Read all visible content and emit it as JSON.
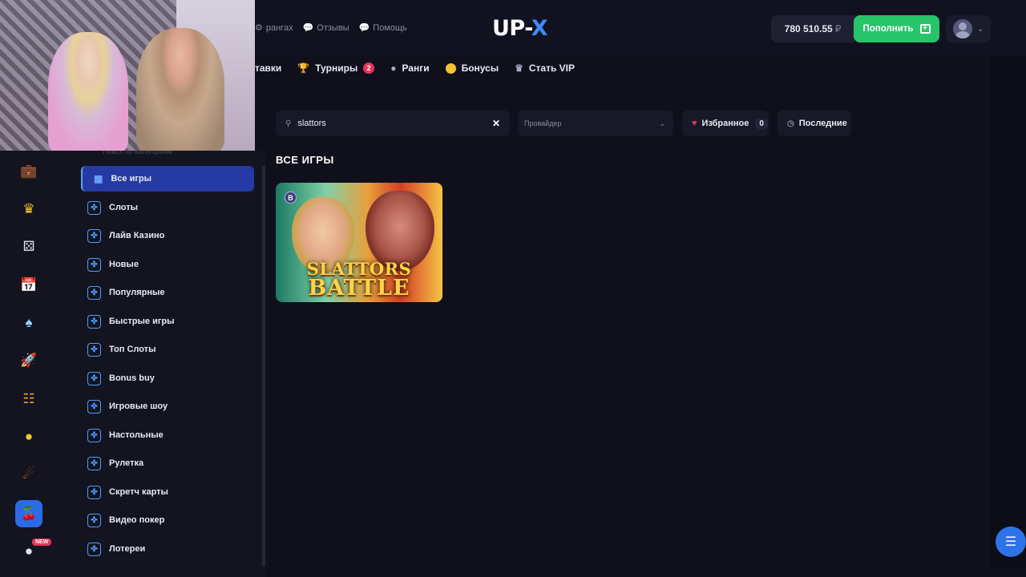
{
  "header": {
    "links": [
      {
        "icon": "rank-icon",
        "label": "рангах"
      },
      {
        "icon": "reviews-icon",
        "label": "Отзывы"
      },
      {
        "icon": "help-icon",
        "label": "Помощь"
      }
    ],
    "logo": {
      "up": "UP-",
      "x": "X"
    },
    "balance": "780 510.55",
    "currency": "₽",
    "deposit_label": "Пополнить"
  },
  "nav": {
    "bets_label": "тавки",
    "tournaments_label": "Турниры",
    "tournaments_badge": "2",
    "ranks_label": "Ранги",
    "bonuses_label": "Бонусы",
    "vip_label": "Стать VIP"
  },
  "filters": {
    "search_value": "slattors",
    "provider_placeholder": "Провайдер",
    "favorites_label": "Избранное",
    "favorites_count": "0",
    "recent_label": "Последние"
  },
  "sidebar": {
    "hidden_label": "Поиск по категориям",
    "categories": [
      {
        "label": "Все игры"
      },
      {
        "label": "Слоты"
      },
      {
        "label": "Лайв Казино"
      },
      {
        "label": "Новые"
      },
      {
        "label": "Популярные"
      },
      {
        "label": "Быстрые игры"
      },
      {
        "label": "Топ Слоты"
      },
      {
        "label": "Bonus buy"
      },
      {
        "label": "Игровые шоу"
      },
      {
        "label": "Настольные"
      },
      {
        "label": "Рулетка"
      },
      {
        "label": "Скретч карты"
      },
      {
        "label": "Видео покер"
      },
      {
        "label": "Лотереи"
      }
    ],
    "new_tag": "NEW"
  },
  "main": {
    "section_title": "ВСЕ ИГРЫ",
    "games": [
      {
        "title_line1": "SLATTORS",
        "title_line2": "BATTLE",
        "badge": "B"
      }
    ]
  }
}
